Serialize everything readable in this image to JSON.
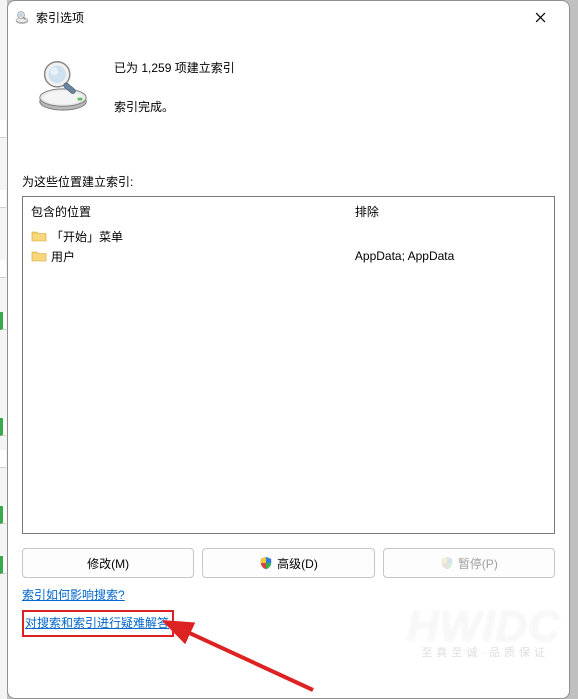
{
  "window": {
    "title": "索引选项"
  },
  "status": {
    "line1": "已为 1,259 项建立索引",
    "line2": "索引完成。"
  },
  "section_label": "为这些位置建立索引:",
  "columns": {
    "included_header": "包含的位置",
    "excluded_header": "排除"
  },
  "locations": [
    {
      "name": "「开始」菜单",
      "exclude": ""
    },
    {
      "name": "用户",
      "exclude": "AppData; AppData"
    }
  ],
  "buttons": {
    "modify": "修改(M)",
    "advanced": "高级(D)",
    "pause": "暂停(P)"
  },
  "links": {
    "how_affects": "索引如何影响搜索?",
    "troubleshoot": "对搜索和索引进行疑难解答"
  },
  "watermark": "HWIDC",
  "watermark_sub": "至真至诚·品质保证"
}
